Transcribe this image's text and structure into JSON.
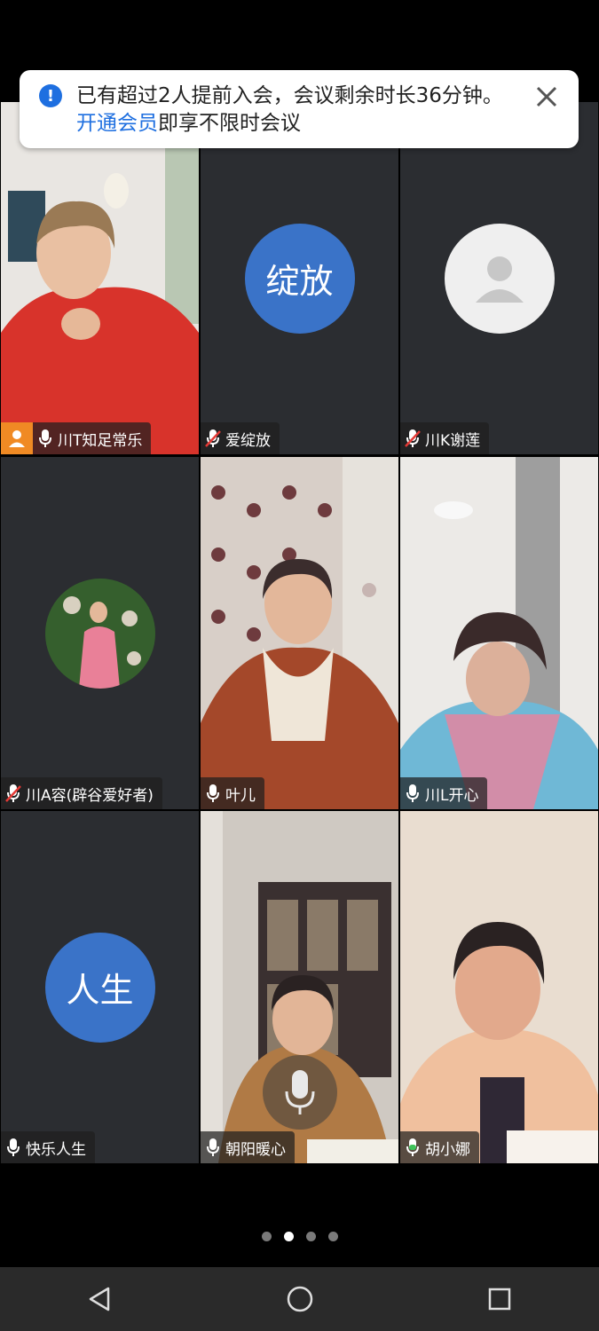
{
  "banner": {
    "icon": "info-icon",
    "text_part1": "已有超过2人提前入会，会议剩余时长36分钟。",
    "link": "开通会员",
    "text_part2": "即享不限时会议",
    "close_icon": "close-icon"
  },
  "participants": [
    {
      "name": "川T知足常乐",
      "mic": "on",
      "host": true,
      "type": "video"
    },
    {
      "name": "爱绽放",
      "mic": "muted",
      "type": "avatar",
      "avatar_text": "绽放",
      "avatar_color": "#3a73c8"
    },
    {
      "name": "川K谢莲",
      "mic": "muted",
      "type": "avatar-default"
    },
    {
      "name": "川A容(辟谷爱好者)",
      "mic": "muted",
      "type": "avatar-photo"
    },
    {
      "name": "叶儿",
      "mic": "on",
      "type": "video",
      "speaking": true
    },
    {
      "name": "川L开心",
      "mic": "on",
      "type": "video"
    },
    {
      "name": "快乐人生",
      "mic": "on",
      "type": "avatar",
      "avatar_text": "人生",
      "avatar_color": "#3a73c8"
    },
    {
      "name": "朝阳暖心",
      "mic": "on",
      "type": "video"
    },
    {
      "name": "胡小娜",
      "mic": "on",
      "type": "video"
    }
  ],
  "pagination": {
    "total": 4,
    "current": 2
  },
  "navbar": {
    "back": "back-triangle-icon",
    "home": "home-circle-icon",
    "recents": "recents-square-icon"
  },
  "colors": {
    "accent": "#1e6fe0",
    "speaking_border": "#3ec35a",
    "host_badge": "#f08a24"
  }
}
